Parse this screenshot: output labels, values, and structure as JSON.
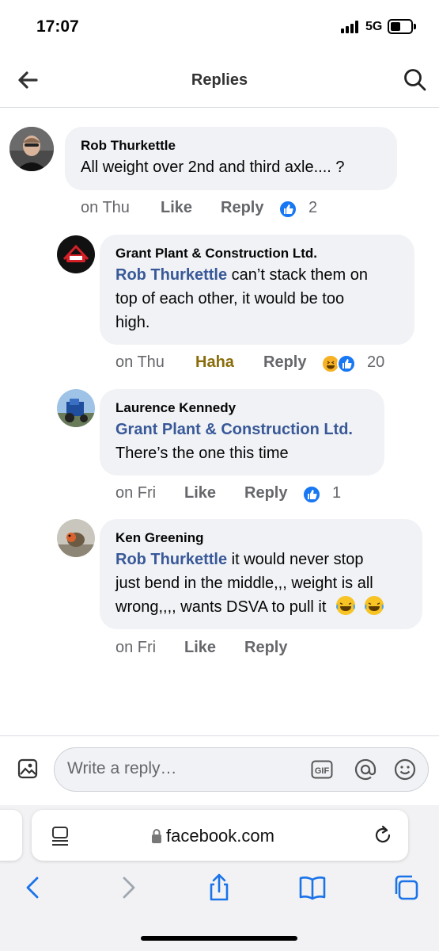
{
  "status_bar": {
    "time": "17:07",
    "network": "5G"
  },
  "header": {
    "title": "Replies",
    "back_icon": "back-arrow-icon",
    "search_icon": "search-icon"
  },
  "comments": [
    {
      "author": "Rob Thurkettle",
      "text": "All weight over 2nd and third axle.... ?",
      "time": "on Thu",
      "reaction_action": "Like",
      "reply_label": "Reply",
      "reaction_count": "2",
      "reaction_icons": [
        "like-icon"
      ]
    },
    {
      "author": "Grant Plant & Construction Ltd.",
      "mention": "Rob Thurkettle",
      "text_line1_rest": " can’t stack them on",
      "text_line2": "top of each other, it would be too",
      "text_line3": "high.",
      "time": "on Thu",
      "reaction_action": "Haha",
      "reply_label": "Reply",
      "reaction_count": "20",
      "reaction_icons": [
        "haha-icon",
        "like-icon"
      ]
    },
    {
      "author": "Laurence Kennedy",
      "mention": "Grant Plant & Construction Ltd.",
      "text_line2": "There’s the one this time",
      "time": "on Fri",
      "reaction_action": "Like",
      "reply_label": "Reply",
      "reaction_count": "1",
      "reaction_icons": [
        "like-icon"
      ]
    },
    {
      "author": "Ken Greening",
      "mention": "Rob Thurkettle",
      "text_line1_rest": " it would never stop",
      "text_line2": "just bend in the middle,,, weight is all",
      "text_line3": "wrong,,,, wants DSVA to pull it",
      "time": "on Fri",
      "reaction_action": "Like",
      "reply_label": "Reply"
    }
  ],
  "composer": {
    "placeholder": "Write a reply…",
    "gif_label": "GIF"
  },
  "browser": {
    "url": "facebook.com"
  },
  "colors": {
    "like_blue": "#1877f2",
    "mention_blue": "#385898",
    "bubble_grey": "#f0f2f5",
    "haha_gold": "#8a6d0b"
  }
}
